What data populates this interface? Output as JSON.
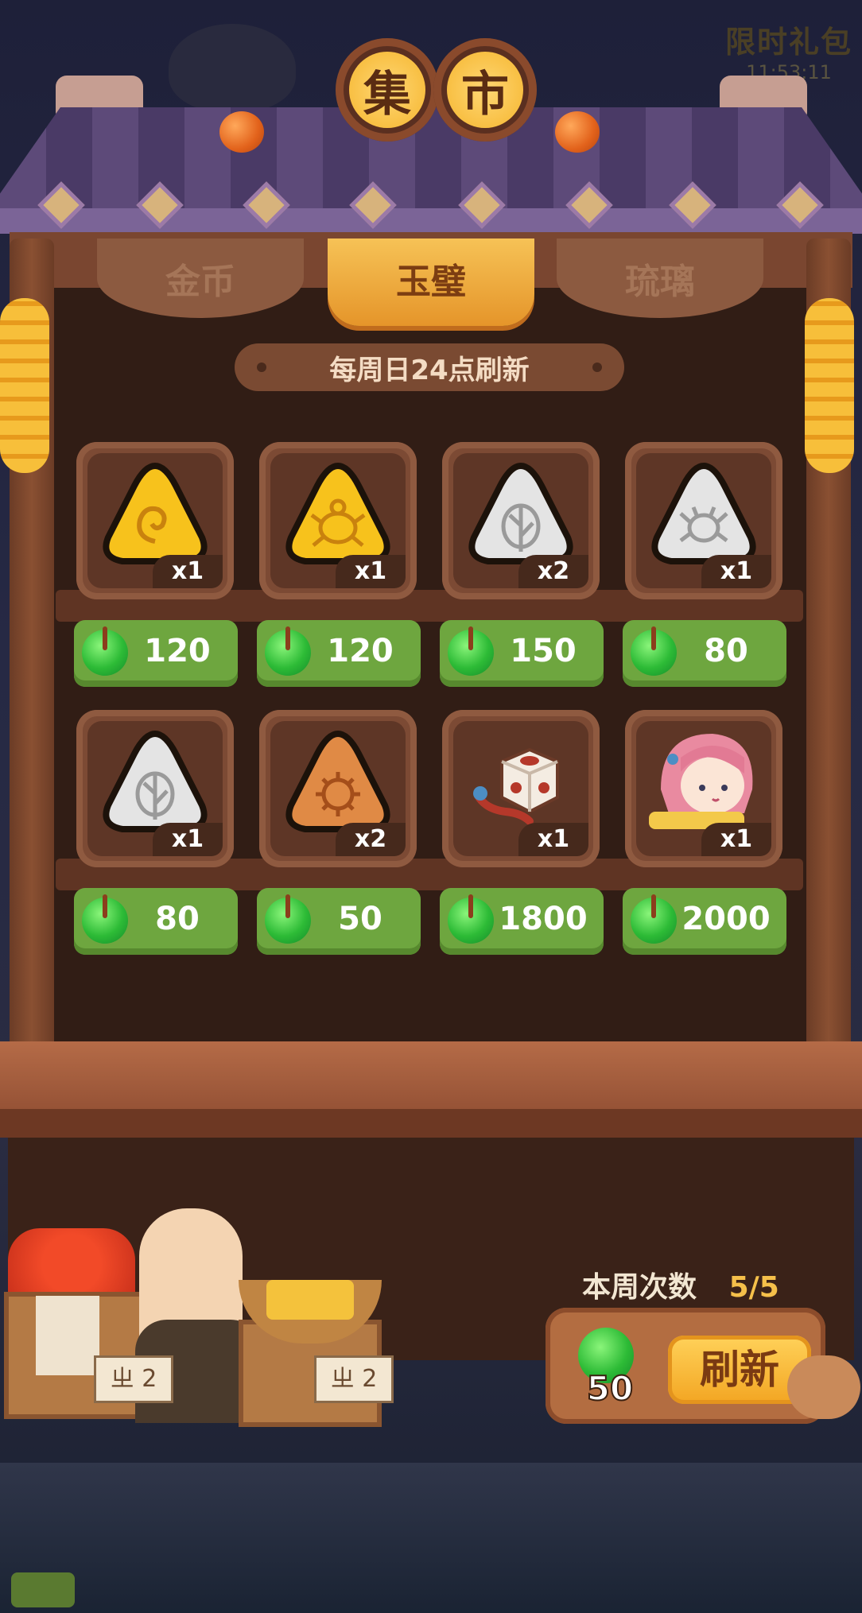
{
  "promo": {
    "title": "限时礼包",
    "timer": "11:53:11"
  },
  "title_chars": [
    "集",
    "市"
  ],
  "tabs": [
    {
      "label": "金币",
      "selected": false
    },
    {
      "label": "玉璧",
      "selected": true
    },
    {
      "label": "琉璃",
      "selected": false
    }
  ],
  "refresh_note": "每周日24点刷新",
  "items": [
    {
      "icon": "gold-spiral-rune-icon",
      "qty": "x1",
      "price": "120"
    },
    {
      "icon": "gold-turtle-rune-icon",
      "qty": "x1",
      "price": "120"
    },
    {
      "icon": "silver-leaf-rune-icon",
      "qty": "x2",
      "price": "150"
    },
    {
      "icon": "silver-crab-rune-icon",
      "qty": "x1",
      "price": "80"
    },
    {
      "icon": "silver-leaf-rune-icon",
      "qty": "x1",
      "price": "80"
    },
    {
      "icon": "bronze-sun-rune-icon",
      "qty": "x2",
      "price": "50"
    },
    {
      "icon": "dice-decoration-icon",
      "qty": "x1",
      "price": "1800"
    },
    {
      "icon": "girl-character-icon",
      "qty": "x1",
      "price": "2000"
    }
  ],
  "currency_icon": "jade-coin-icon",
  "vendor_signs": [
    "ㄓ 2",
    "ㄓ 2"
  ],
  "weekly": {
    "label": "本周次数",
    "value": "5/5"
  },
  "refresh": {
    "cost": "50",
    "label": "刷新"
  },
  "colors": {
    "price_green": "#6ea63f",
    "tab_active": "#f3b043",
    "board": "#311d15"
  }
}
